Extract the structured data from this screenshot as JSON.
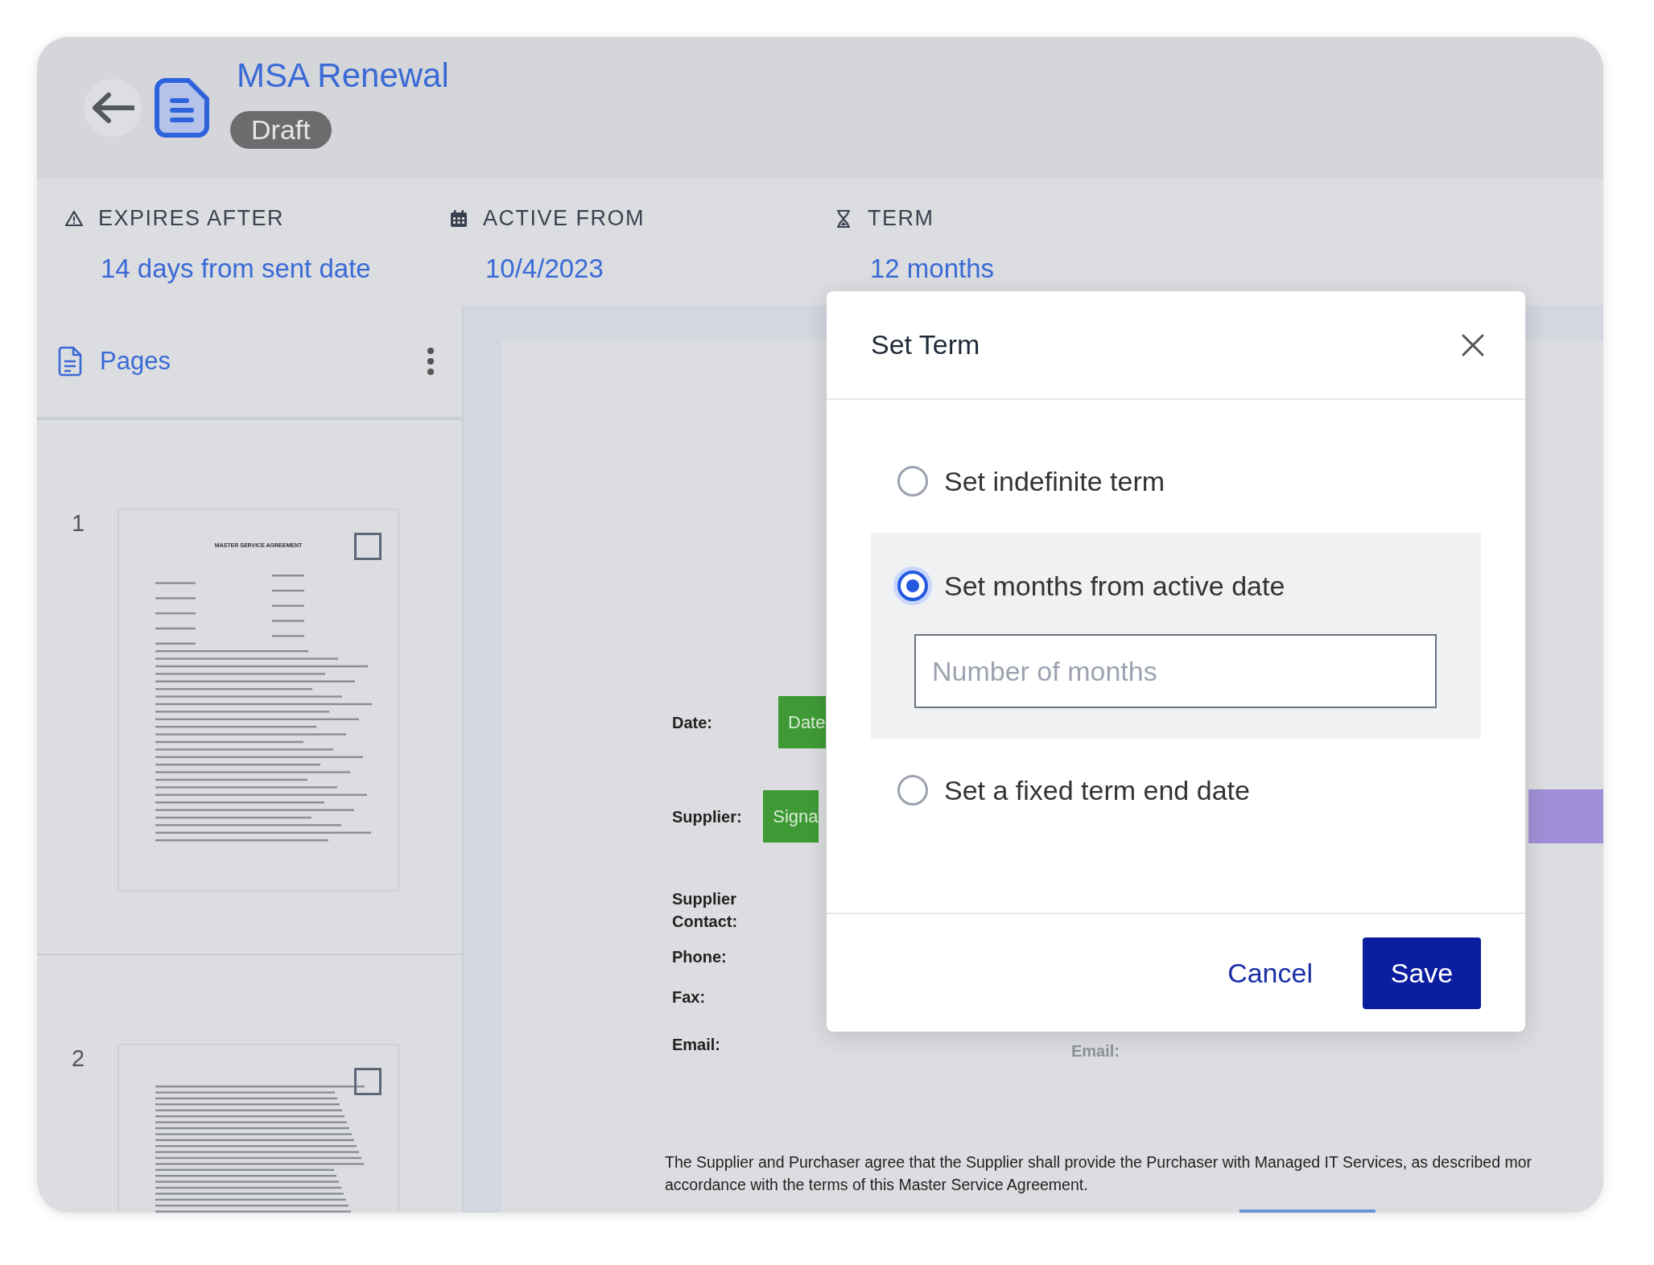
{
  "header": {
    "title": "MSA Renewal",
    "status": "Draft"
  },
  "summary": [
    {
      "kind": "warning",
      "label": "EXPIRES AFTER",
      "value": "14 days from sent date"
    },
    {
      "kind": "calendar",
      "label": "ACTIVE FROM",
      "value": "10/4/2023"
    },
    {
      "kind": "hourglass",
      "label": "TERM",
      "value": "12 months"
    }
  ],
  "sidebar": {
    "title": "Pages",
    "pages": [
      {
        "number": "1",
        "heading": "MASTER SERVICE AGREEMENT",
        "checked": false
      },
      {
        "number": "2",
        "checked": false
      }
    ]
  },
  "document": {
    "rows": [
      {
        "kind": "date",
        "label": "Date:",
        "field": "Date"
      },
      {
        "kind": "signature",
        "label": "Supplier:",
        "field": "Signa"
      },
      {
        "kind": "text",
        "label": "Supplier Contact:"
      },
      {
        "kind": "text",
        "label": "Phone:"
      },
      {
        "kind": "text",
        "label": "Fax:"
      },
      {
        "kind": "text",
        "label": "Email:",
        "second_label": "Email:"
      }
    ],
    "paragraph": [
      "The Supplier and Purchaser agree that the Supplier shall provide the Purchaser with Managed IT Services, as described mor",
      "accordance with the terms of this Master Service Agreement."
    ]
  },
  "modal": {
    "title": "Set Term",
    "options": [
      {
        "label": "Set indefinite term",
        "selected": false
      },
      {
        "label": "Set months from active date",
        "selected": true,
        "placeholder": "Number of months"
      },
      {
        "label": "Set a fixed term end date",
        "selected": false
      }
    ],
    "cancel": "Cancel",
    "save": "Save"
  }
}
